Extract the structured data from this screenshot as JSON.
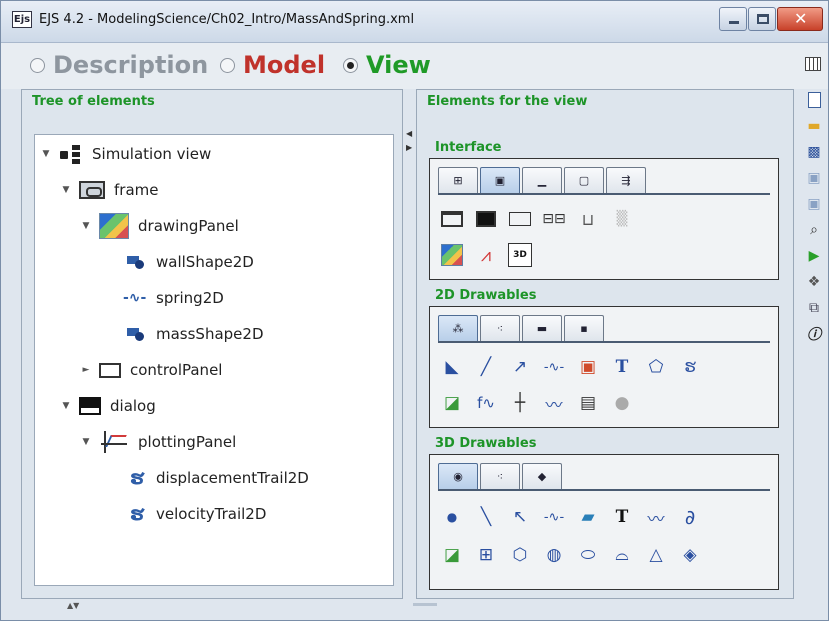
{
  "window": {
    "title": "EJS 4.2 - ModelingScience/Ch02_Intro/MassAndSpring.xml",
    "app_badge": "Ejs"
  },
  "modes": [
    {
      "label": "Description",
      "selected": false,
      "color": "#8e969f"
    },
    {
      "label": "Model",
      "selected": false,
      "color": "#c0322b"
    },
    {
      "label": "View",
      "selected": true,
      "color": "#1f9a27"
    }
  ],
  "left": {
    "title": "Tree of elements",
    "tree": [
      {
        "label": "Simulation view",
        "icon": "simulation-view-icon",
        "expander": "▼"
      },
      {
        "label": "frame",
        "icon": "frame-icon",
        "expander": "▼"
      },
      {
        "label": "drawingPanel",
        "icon": "drawing-panel-icon",
        "expander": "▼"
      },
      {
        "label": "wallShape2D",
        "icon": "shape2d-icon"
      },
      {
        "label": "spring2D",
        "icon": "spring-icon"
      },
      {
        "label": "massShape2D",
        "icon": "shape2d-icon"
      },
      {
        "label": "controlPanel",
        "icon": "panel-icon",
        "expander": "►"
      },
      {
        "label": "dialog",
        "icon": "dialog-icon",
        "expander": "▼"
      },
      {
        "label": "plottingPanel",
        "icon": "plotting-panel-icon",
        "expander": "▼"
      },
      {
        "label": "displacementTrail2D",
        "icon": "trail-icon"
      },
      {
        "label": "velocityTrail2D",
        "icon": "trail-icon"
      }
    ]
  },
  "right": {
    "title": "Elements for the view",
    "groups": [
      {
        "title": "Interface",
        "tabs": [
          "⊞",
          "▣",
          "▁",
          "▢",
          "⇶"
        ]
      },
      {
        "title": "2D Drawables",
        "tabs": [
          "⁂",
          "⁖",
          "▬",
          "▪"
        ]
      },
      {
        "title": "3D Drawables",
        "tabs": [
          "◉",
          "⁖",
          "◆"
        ]
      }
    ]
  },
  "colors": {
    "group_title": "#1d9428",
    "border": "#333333"
  }
}
